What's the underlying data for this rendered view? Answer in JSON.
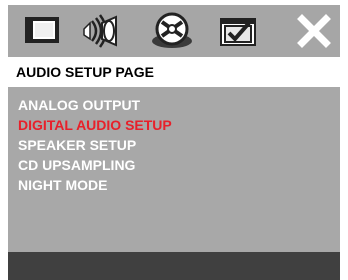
{
  "header": {
    "tabs": [
      {
        "icon": "tv-screen-icon",
        "selected": false
      },
      {
        "icon": "speaker-audio-icon",
        "selected": false
      },
      {
        "icon": "disc-icon",
        "selected": true
      },
      {
        "icon": "preferences-checkbox-icon",
        "selected": false
      },
      {
        "icon": "exit-x-icon",
        "selected": false
      }
    ]
  },
  "page_title": "AUDIO SETUP PAGE",
  "menu": {
    "items": [
      {
        "label": "ANALOG OUTPUT",
        "selected": false
      },
      {
        "label": "DIGITAL AUDIO SETUP",
        "selected": true
      },
      {
        "label": "SPEAKER SETUP",
        "selected": false
      },
      {
        "label": "CD UPSAMPLING",
        "selected": false
      },
      {
        "label": "NIGHT MODE",
        "selected": false
      }
    ]
  },
  "colors": {
    "panel": "#a8a8a8",
    "title_bar": "#ffffff",
    "text": "#ffffff",
    "highlight": "#e8202a",
    "footer": "#404040"
  }
}
